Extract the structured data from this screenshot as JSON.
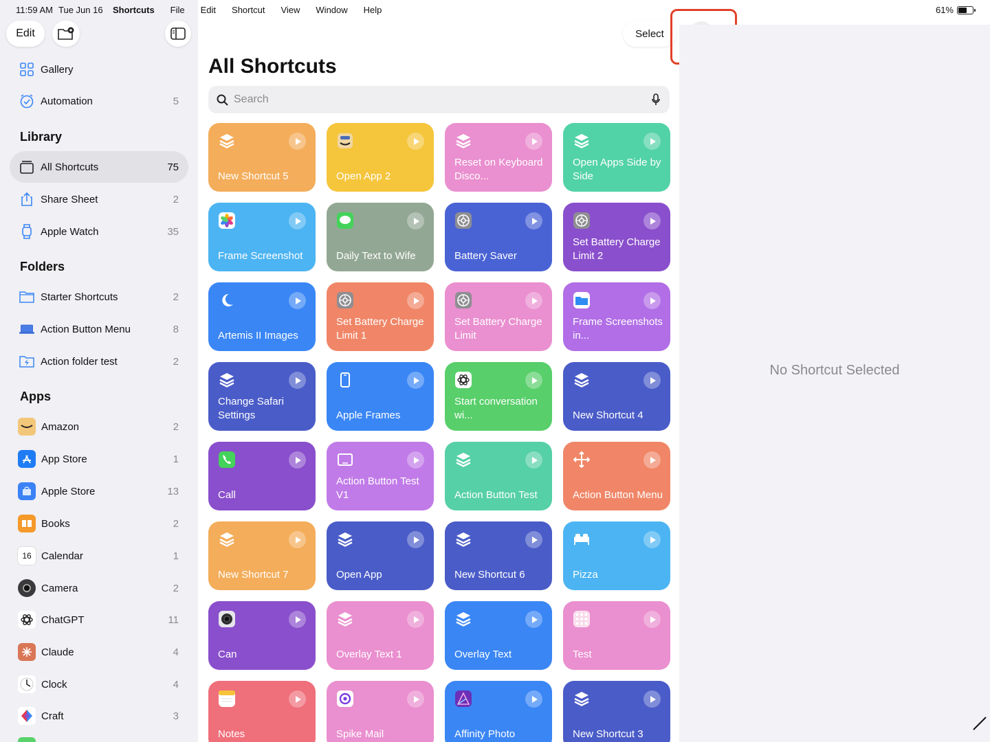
{
  "status": {
    "time": "11:59 AM",
    "date": "Tue Jun 16",
    "battery": "61%"
  },
  "menu": [
    "Shortcuts",
    "File",
    "Edit",
    "Shortcut",
    "View",
    "Window",
    "Help"
  ],
  "sidebar": {
    "edit_label": "Edit",
    "top_items": [
      {
        "label": "Gallery",
        "count": ""
      },
      {
        "label": "Automation",
        "count": "5"
      }
    ],
    "library_header": "Library",
    "library": [
      {
        "label": "All Shortcuts",
        "count": "75"
      },
      {
        "label": "Share Sheet",
        "count": "2"
      },
      {
        "label": "Apple Watch",
        "count": "35"
      }
    ],
    "folders_header": "Folders",
    "folders": [
      {
        "label": "Starter Shortcuts",
        "count": "2"
      },
      {
        "label": "Action Button Menu",
        "count": "8"
      },
      {
        "label": "Action folder test",
        "count": "2"
      }
    ],
    "apps_header": "Apps",
    "apps": [
      {
        "label": "Amazon",
        "count": "2",
        "color": "#f3c77a"
      },
      {
        "label": "App Store",
        "count": "1",
        "color": "#1f7cf5"
      },
      {
        "label": "Apple Store",
        "count": "13",
        "color": "#3b82f6"
      },
      {
        "label": "Books",
        "count": "2",
        "color": "#f59a2a"
      },
      {
        "label": "Calendar",
        "count": "1",
        "color": "#ffffff"
      },
      {
        "label": "Camera",
        "count": "2",
        "color": "#3a3a3c"
      },
      {
        "label": "ChatGPT",
        "count": "11",
        "color": "#ffffff"
      },
      {
        "label": "Claude",
        "count": "4",
        "color": "#d97757"
      },
      {
        "label": "Clock",
        "count": "4",
        "color": "#ffffff"
      },
      {
        "label": "Craft",
        "count": "3",
        "color": "#ffffff"
      }
    ]
  },
  "main": {
    "title": "All Shortcuts",
    "select_label": "Select",
    "search_placeholder": "Search",
    "shortcuts": [
      {
        "label": "New Shortcut 5",
        "color": "#f4ad5a",
        "icon": "layers-icon"
      },
      {
        "label": "Open App 2",
        "color": "#f5c53c",
        "icon": "amazon-icon"
      },
      {
        "label": "Reset on Keyboard Disco...",
        "color": "#ea8fcf",
        "icon": "layers-icon"
      },
      {
        "label": "Open Apps Side by Side",
        "color": "#52d2a7",
        "icon": "layers-icon"
      },
      {
        "label": "Frame Screenshot",
        "color": "#4cb4f2",
        "icon": "photos-icon"
      },
      {
        "label": "Daily Text to Wife",
        "color": "#93a894",
        "icon": "messages-icon"
      },
      {
        "label": "Battery Saver",
        "color": "#4a63d4",
        "icon": "settings-icon"
      },
      {
        "label": "Set Battery Charge Limit 2",
        "color": "#8a4fcc",
        "icon": "settings-icon"
      },
      {
        "label": "Artemis II Images",
        "color": "#3a86f5",
        "icon": "moon-icon"
      },
      {
        "label": "Set Battery Charge Limit 1",
        "color": "#f08667",
        "icon": "settings-icon"
      },
      {
        "label": "Set Battery Charge Limit",
        "color": "#ea8fcf",
        "icon": "settings-icon"
      },
      {
        "label": "Frame Screenshots in...",
        "color": "#b16ee6",
        "icon": "files-icon"
      },
      {
        "label": "Change Safari Settings",
        "color": "#4a5cc8",
        "icon": "layers-icon"
      },
      {
        "label": "Apple Frames",
        "color": "#3a86f5",
        "icon": "phone-outline-icon"
      },
      {
        "label": "Start conversation wi...",
        "color": "#58cf6a",
        "icon": "chatgpt-icon"
      },
      {
        "label": "New Shortcut 4",
        "color": "#4a5cc8",
        "icon": "layers-icon"
      },
      {
        "label": "Call",
        "color": "#8a4fcc",
        "icon": "phone-icon"
      },
      {
        "label": "Action Button Test V1",
        "color": "#c17be8",
        "icon": "tablet-icon"
      },
      {
        "label": "Action Button Test",
        "color": "#56d0a6",
        "icon": "layers-icon"
      },
      {
        "label": "Action Button Menu",
        "color": "#f08667",
        "icon": "move-icon"
      },
      {
        "label": "New Shortcut 7",
        "color": "#f4ad5a",
        "icon": "layers-icon"
      },
      {
        "label": "Open App",
        "color": "#4a5cc8",
        "icon": "layers-icon"
      },
      {
        "label": "New Shortcut 6",
        "color": "#4a5cc8",
        "icon": "layers-icon"
      },
      {
        "label": "Pizza",
        "color": "#4cb4f2",
        "icon": "bed-icon"
      },
      {
        "label": "Can",
        "color": "#8a4fcc",
        "icon": "camera-icon"
      },
      {
        "label": "Overlay Text 1",
        "color": "#ea8fcf",
        "icon": "layers-icon"
      },
      {
        "label": "Overlay Text",
        "color": "#3a86f5",
        "icon": "layers-icon"
      },
      {
        "label": "Test",
        "color": "#ea8fcf",
        "icon": "grid-icon"
      },
      {
        "label": "Notes",
        "color": "#ef6f7b",
        "icon": "notes-icon"
      },
      {
        "label": "Spike Mail",
        "color": "#ea8fcf",
        "icon": "spike-icon"
      },
      {
        "label": "Affinity Photo",
        "color": "#3a86f5",
        "icon": "affinity-icon"
      },
      {
        "label": "New Shortcut 3",
        "color": "#4a5cc8",
        "icon": "layers-icon"
      }
    ]
  },
  "detail": {
    "empty_text": "No Shortcut Selected"
  },
  "accent": "#e0412a"
}
